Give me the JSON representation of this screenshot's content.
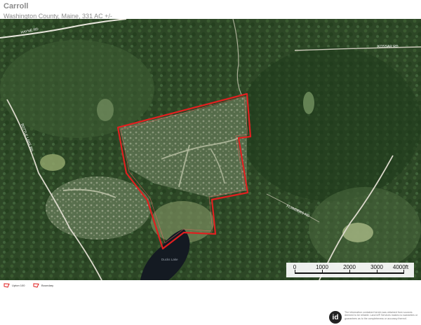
{
  "header": {
    "title": "Carroll",
    "subtitle": "Washington County, Maine, 331 AC +/-"
  },
  "map": {
    "road_labels": [
      "HAYNE RD",
      "BOTTLE LAKE RD",
      "KOSSAR RD",
      "FLANDERS RD"
    ],
    "water_label": "Ducks Lake",
    "boundary_color": "#e02020",
    "scale": {
      "labels": [
        "0",
        "1000",
        "2000",
        "3000",
        "4000ft"
      ]
    }
  },
  "legend": {
    "items": [
      {
        "label": "Upton 100",
        "color": "#e02020"
      },
      {
        "label": "Boundary",
        "color": "#e02020"
      }
    ]
  },
  "footer": {
    "logo_text": "id",
    "disclaimer": "The information contained herein was obtained from sources deemed to be reliable. Land id® Services makes no warranties or guarantees as to the completeness or accuracy thereof."
  }
}
